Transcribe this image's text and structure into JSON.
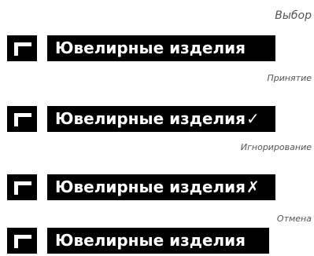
{
  "states": [
    {
      "caption": "Выбор",
      "label": "Ювелирные изделия",
      "mark": ""
    },
    {
      "caption": "Принятие",
      "label": "Ювелирные изделия",
      "mark": "✓"
    },
    {
      "caption": "Игнорирование",
      "label": "Ювелирные изделия",
      "mark": "✗"
    },
    {
      "caption": "Отмена",
      "label": "Ювелирные изделия",
      "mark": ""
    }
  ],
  "icons": {
    "item_icon": "flag-icon",
    "accept_icon": "checkmark-icon",
    "ignore_icon": "cross-icon"
  },
  "colors": {
    "bar_background": "#000000",
    "bar_text": "#ffffff",
    "caption_text": "#555555"
  }
}
